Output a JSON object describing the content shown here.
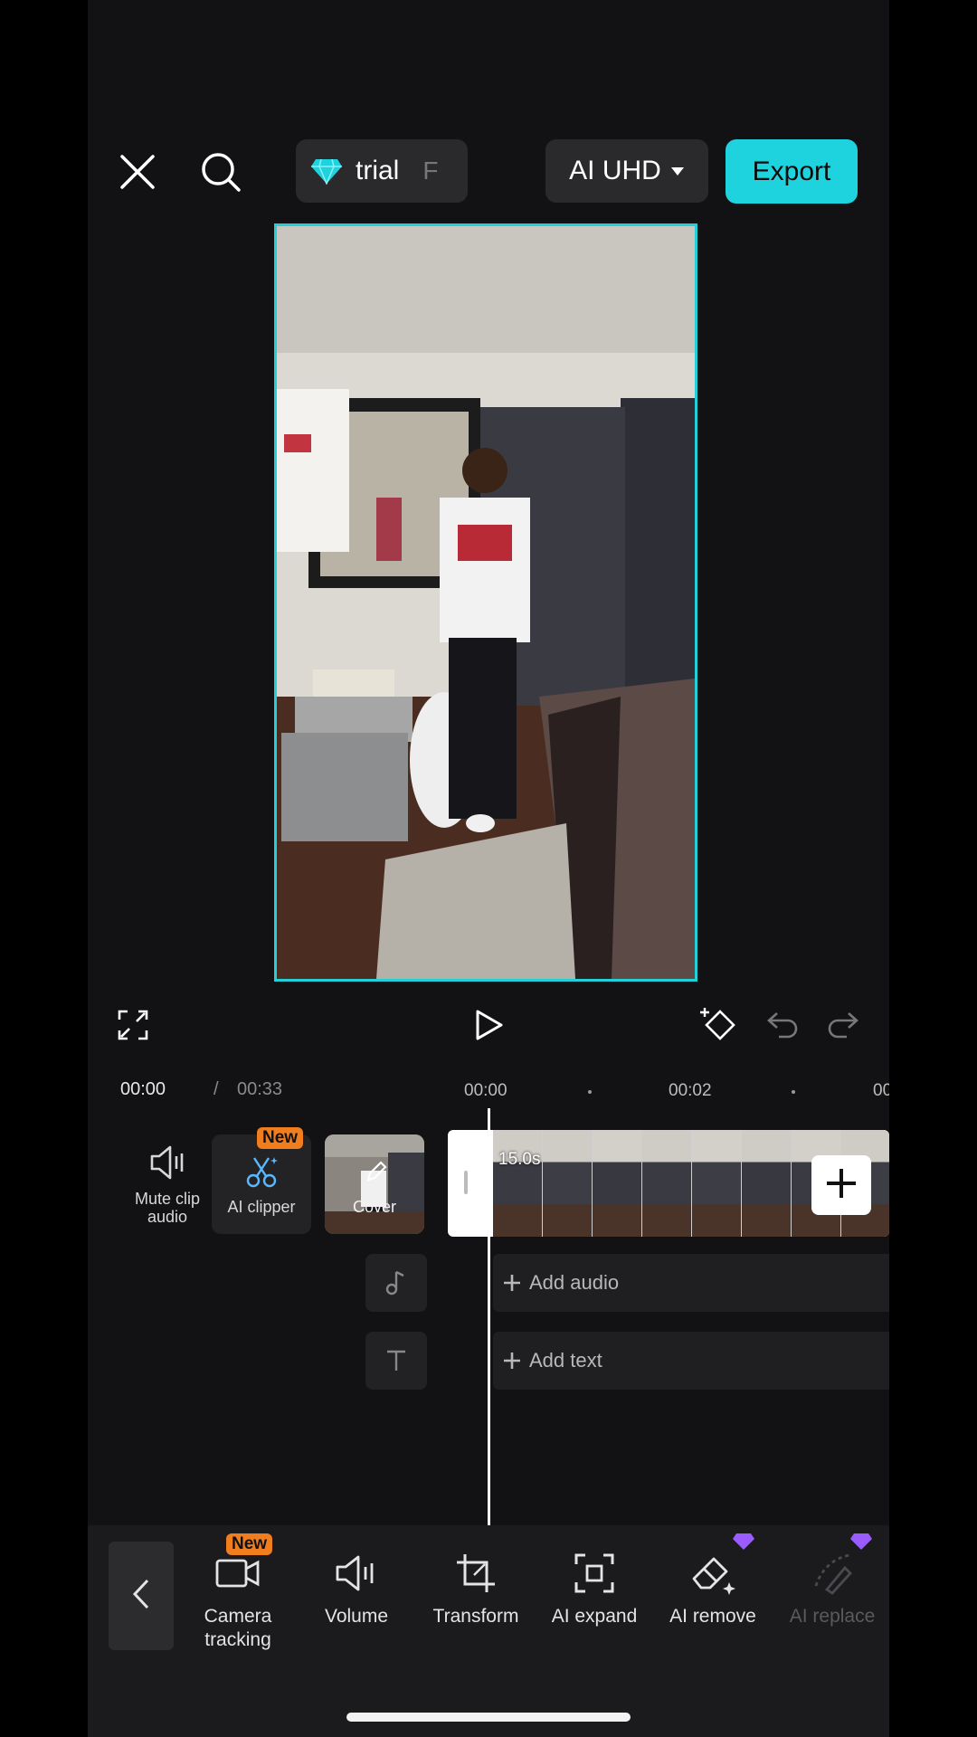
{
  "header": {
    "close_icon": "close-icon",
    "search_icon": "search-icon",
    "trial_label": "trial",
    "trial_extra": "F",
    "quality_label": "AI UHD",
    "export_label": "Export"
  },
  "colors": {
    "accent": "#1fd3de",
    "badge": "#f07d1e",
    "pro": "#9b5cff"
  },
  "playback": {
    "current_time": "00:00",
    "separator": "/",
    "total_time": "00:33",
    "ruler": [
      "00:00",
      "00:02",
      "00"
    ]
  },
  "tools_left": {
    "mute_label": "Mute clip audio",
    "ai_clipper_label": "AI clipper",
    "new_badge": "New",
    "cover_label": "Cover"
  },
  "timeline": {
    "clip_duration": "15.0s",
    "add_audio": "Add audio",
    "add_text": "Add text"
  },
  "toolbar": {
    "new_badge": "New",
    "items": [
      {
        "label": "Camera tracking"
      },
      {
        "label": "Volume"
      },
      {
        "label": "Transform"
      },
      {
        "label": "AI expand"
      },
      {
        "label": "AI remove"
      },
      {
        "label": "AI replace"
      }
    ]
  }
}
